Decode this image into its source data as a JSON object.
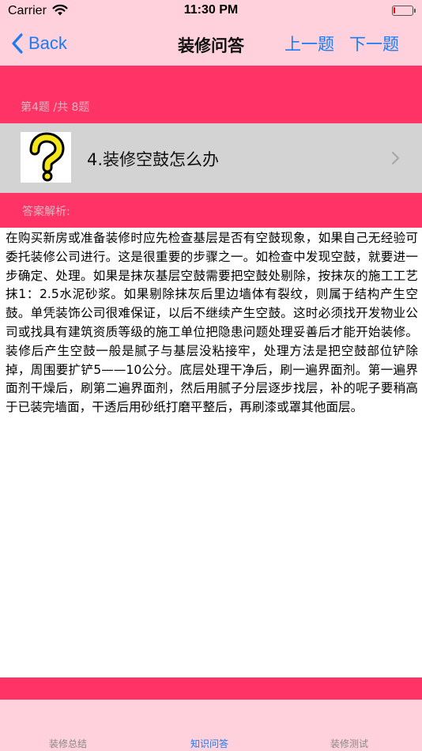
{
  "status_bar": {
    "carrier": "Carrier",
    "time": "11:30 PM"
  },
  "nav": {
    "back_label": "Back",
    "title": "装修问答",
    "prev_label": "上一题",
    "next_label": "下一题"
  },
  "progress": {
    "label": "第4题 /共 8题"
  },
  "question": {
    "text": "4.装修空鼓怎么办",
    "icon": "question-mark-icon"
  },
  "answer": {
    "label": "答案解析:",
    "body": "在购买新房或准备装修时应先检查基层是否有空鼓现象，如果自己无经验可委托装修公司进行。这是很重要的步骤之一。如检查中发现空鼓，就要进一步确定、处理。如果是抹灰基层空鼓需要把空鼓处剔除，按抹灰的施工工艺抹1：2.5水泥砂浆。如果剔除抹灰后里边墙体有裂纹，则属于结构产生空鼓。单凭装饰公司很难保证，以后不继续产生空鼓。这时必须找开发物业公司或找具有建筑资质等级的施工单位把隐患问题处理妥善后才能开始装修。装修后产生空鼓一般是腻子与基层没粘接牢，处理方法是把空鼓部位铲除掉，周围要扩铲5——10公分。底层处理干净后，刷一遍界面剂。第一遍界面剂干燥后，刷第二遍界面剂，然后用腻子分层逐步找层，补的呢子要稍高于已装完墙面，干透后用砂纸打磨平整后，再刷漆或罩其他面层。"
  },
  "tabs": [
    {
      "label": "装修总结"
    },
    {
      "label": "知识问答"
    },
    {
      "label": "装修测试"
    }
  ],
  "colors": {
    "pink_bar": "#ffd1dc",
    "accent_band": "#ff3366",
    "link_blue": "#1a7cf2",
    "row_gray": "#d3d3d3"
  }
}
